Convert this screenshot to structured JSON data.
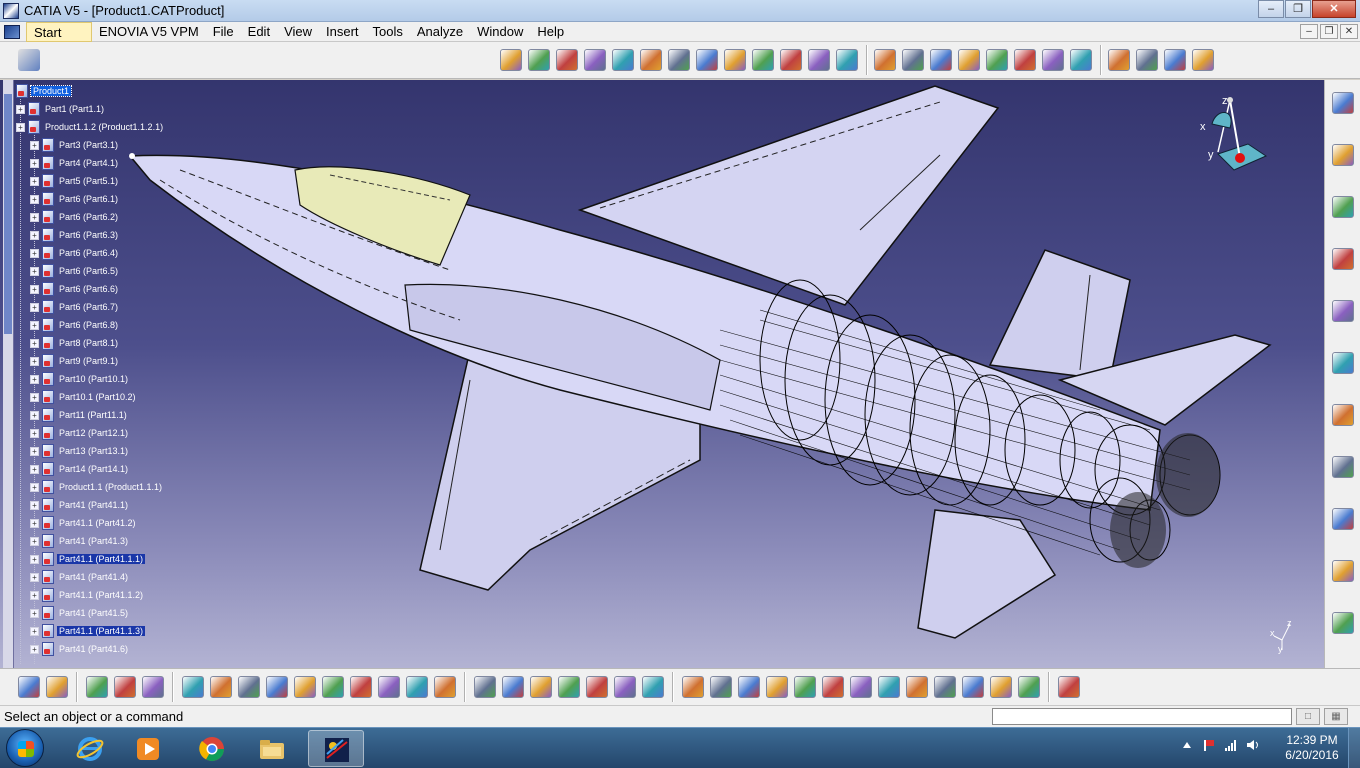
{
  "window": {
    "title": "CATIA V5 - [Product1.CATProduct]"
  },
  "menu": {
    "items": [
      "Start",
      "ENOVIA V5 VPM",
      "File",
      "Edit",
      "View",
      "Insert",
      "Tools",
      "Analyze",
      "Window",
      "Help"
    ]
  },
  "tree": {
    "root": "Product1",
    "items": [
      {
        "label": "Part1 (Part1.1)",
        "level": 1,
        "style": "normal"
      },
      {
        "label": "Product1.1.2 (Product1.1.2.1)",
        "level": 1,
        "style": "normal"
      },
      {
        "label": "Part3 (Part3.1)",
        "level": 2,
        "style": "normal"
      },
      {
        "label": "Part4 (Part4.1)",
        "level": 2,
        "style": "normal"
      },
      {
        "label": "Part5 (Part5.1)",
        "level": 2,
        "style": "normal"
      },
      {
        "label": "Part6 (Part6.1)",
        "level": 2,
        "style": "normal"
      },
      {
        "label": "Part6 (Part6.2)",
        "level": 2,
        "style": "normal"
      },
      {
        "label": "Part6 (Part6.3)",
        "level": 2,
        "style": "normal"
      },
      {
        "label": "Part6 (Part6.4)",
        "level": 2,
        "style": "normal"
      },
      {
        "label": "Part6 (Part6.5)",
        "level": 2,
        "style": "normal"
      },
      {
        "label": "Part6 (Part6.6)",
        "level": 2,
        "style": "normal"
      },
      {
        "label": "Part6 (Part6.7)",
        "level": 2,
        "style": "normal"
      },
      {
        "label": "Part6 (Part6.8)",
        "level": 2,
        "style": "normal"
      },
      {
        "label": "Part8 (Part8.1)",
        "level": 2,
        "style": "normal"
      },
      {
        "label": "Part9 (Part9.1)",
        "level": 2,
        "style": "normal"
      },
      {
        "label": "Part10 (Part10.1)",
        "level": 2,
        "style": "normal"
      },
      {
        "label": "Part10.1 (Part10.2)",
        "level": 2,
        "style": "normal"
      },
      {
        "label": "Part11 (Part11.1)",
        "level": 2,
        "style": "normal"
      },
      {
        "label": "Part12 (Part12.1)",
        "level": 2,
        "style": "normal"
      },
      {
        "label": "Part13 (Part13.1)",
        "level": 2,
        "style": "normal"
      },
      {
        "label": "Part14 (Part14.1)",
        "level": 2,
        "style": "normal"
      },
      {
        "label": "Product1.1 (Product1.1.1)",
        "level": 2,
        "style": "normal"
      },
      {
        "label": "Part41 (Part41.1)",
        "level": 2,
        "style": "normal"
      },
      {
        "label": "Part41.1 (Part41.2)",
        "level": 2,
        "style": "normal"
      },
      {
        "label": "Part41 (Part41.3)",
        "level": 2,
        "style": "normal"
      },
      {
        "label": "Part41.1 (Part41.1.1)",
        "level": 2,
        "style": "hl"
      },
      {
        "label": "Part41 (Part41.4)",
        "level": 2,
        "style": "normal"
      },
      {
        "label": "Part41.1 (Part41.1.2)",
        "level": 2,
        "style": "normal"
      },
      {
        "label": "Part41 (Part41.5)",
        "level": 2,
        "style": "normal"
      },
      {
        "label": "Part41.1 (Part41.1.3)",
        "level": 2,
        "style": "hl"
      },
      {
        "label": "Part41 (Part41.6)",
        "level": 2,
        "style": "normal"
      }
    ]
  },
  "compass": {
    "x_label": "x",
    "y_label": "y",
    "z_label": "z"
  },
  "statusbar": {
    "text": "Select an object or a command",
    "input_value": ""
  },
  "taskbar": {
    "time": "12:39 PM",
    "date": "6/20/2016"
  },
  "colors": {
    "viewport_top": "#34356e",
    "viewport_bottom": "#b3b3d3",
    "jet_body": "#d6d6f4",
    "jet_canopy": "#e8eab8",
    "accent_orange": "#f39b1c"
  },
  "icons": {
    "top_toolbar": [
      "product-management-icon",
      "assembly-icon",
      "constraint-icon",
      "snap-icon",
      "manipulation-icon",
      "compass-icon",
      "explode-icon",
      "clash-icon",
      "sectioning-icon",
      "distance-icon",
      "scenes-icon",
      "catalog-icon",
      "publication-icon",
      "bom-icon",
      "annotation-icon",
      "tolerance-icon",
      "part-design-icon",
      "sketch-icon",
      "wireframe-icon",
      "surface-icon",
      "measure-icon",
      "analysis-icon",
      "generate-icon",
      "reuse-icon",
      "update-icon",
      "multi-view-icon"
    ],
    "bottom_toolbar": [
      "camera-icon",
      "grid-icon",
      "knowledge-icon",
      "law-icon",
      "formula-icon",
      "new-icon",
      "open-icon",
      "save-icon",
      "print-icon",
      "cut-icon",
      "copy-icon",
      "paste-icon",
      "undo-icon",
      "redo-icon",
      "whats-this-icon",
      "fx-icon",
      "comment-icon",
      "parameter-icon",
      "table-icon",
      "tree-icon",
      "lock-icon",
      "spec-icon",
      "fly-icon",
      "fit-all-icon",
      "pan-icon",
      "rotate-icon",
      "zoom-in-icon",
      "zoom-out-icon",
      "normal-view-icon",
      "iso-view-icon",
      "shading-icon",
      "hide-show-icon",
      "swap-icon",
      "apply-material-icon",
      "render-icon",
      "app-loading-icon"
    ],
    "right_toolbar": [
      "settings-icon",
      "table-view-icon",
      "tools-icon",
      "select-icon",
      "constraint-mode-icon",
      "bend-icon",
      "insert-part-icon",
      "replace-icon",
      "product-icon",
      "explode-view-icon",
      "workbench-icon"
    ]
  }
}
